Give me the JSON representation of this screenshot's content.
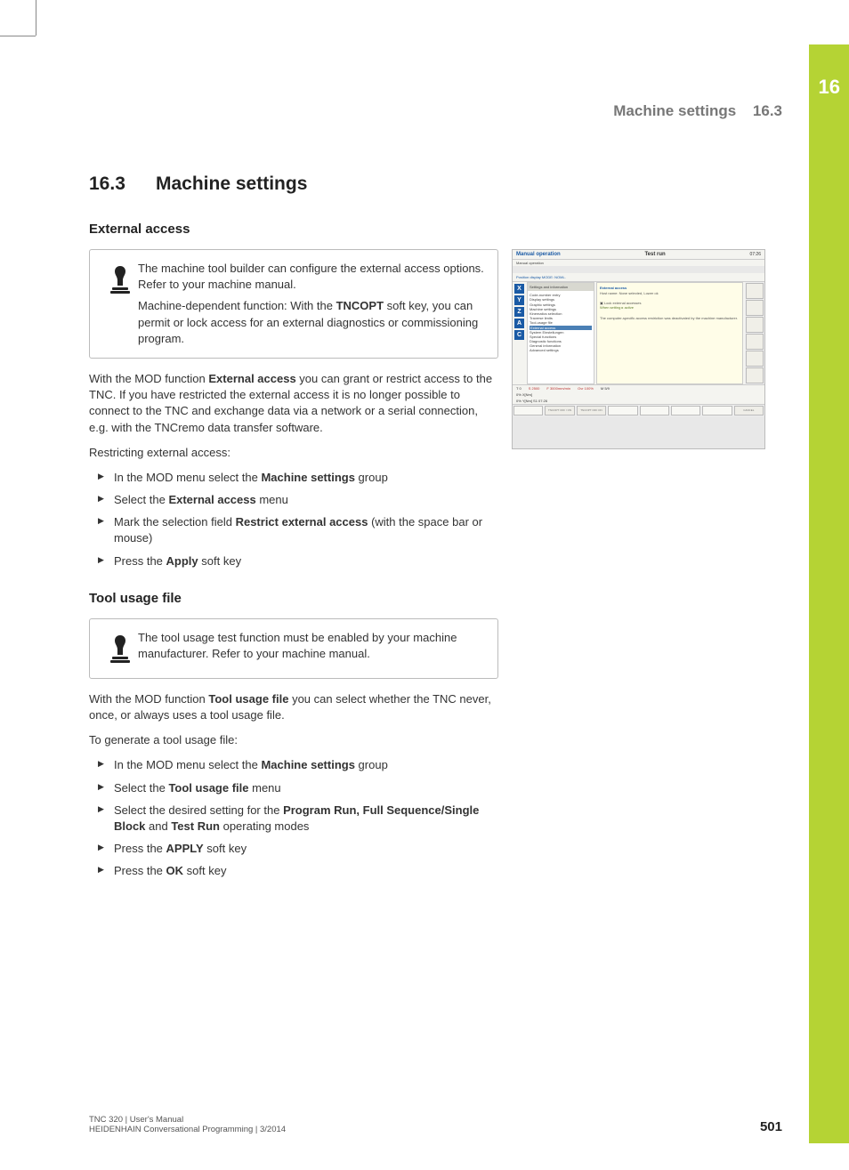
{
  "chapter_number": "16",
  "header": {
    "title": "Machine settings",
    "section": "16.3"
  },
  "section": {
    "number": "16.3",
    "title": "Machine settings"
  },
  "external_access": {
    "heading": "External access",
    "note_p1": "The machine tool builder can configure the external access options. Refer to your machine manual.",
    "note_p2a": "Machine-dependent function: With the ",
    "note_p2b": "TNCOPT",
    "note_p2c": " soft key, you can permit or lock access for an external diagnostics or commissioning program.",
    "body_a": "With the MOD function ",
    "body_b": "External access",
    "body_c": " you can grant or restrict access to the TNC. If you have restricted the external access it is no longer possible to connect to the TNC and exchange data via a network or a serial connection, e.g. with the TNCremo data transfer software.",
    "intro_steps": "Restricting external access:",
    "steps": {
      "s1a": "In the MOD menu select the ",
      "s1b": "Machine settings",
      "s1c": " group",
      "s2a": "Select the ",
      "s2b": "External access",
      "s2c": " menu",
      "s3a": "Mark the selection field ",
      "s3b": "Restrict external access",
      "s3c": " (with the space bar or mouse)",
      "s4a": "Press the ",
      "s4b": "Apply",
      "s4c": " soft key"
    }
  },
  "tool_usage": {
    "heading": "Tool usage file",
    "note": "The tool usage test function must be enabled by your machine manufacturer. Refer to your machine manual.",
    "body_a": "With the MOD function ",
    "body_b": "Tool usage file",
    "body_c": " you can select whether the TNC never, once, or always uses a tool usage file.",
    "intro_steps": "To generate a tool usage file:",
    "steps": {
      "s1a": "In the MOD menu select the ",
      "s1b": "Machine settings",
      "s1c": " group",
      "s2a": "Select the ",
      "s2b": "Tool usage file",
      "s2c": " menu",
      "s3a": "Select the desired setting for the ",
      "s3b": "Program Run, Full Sequence/Single Block",
      "s3c": " and ",
      "s3d": "Test Run",
      "s3e": " operating modes",
      "s4a": "Press the ",
      "s4b": "APPLY",
      "s4c": " soft key",
      "s5a": "Press the ",
      "s5b": "OK",
      "s5c": " soft key"
    }
  },
  "screenshot": {
    "title_left": "Manual operation",
    "title_right": "Test run",
    "time": "07:26",
    "subtitle": "Manual operation",
    "pos_line": "Position display MODE: NOML.",
    "axes": [
      "X",
      "Y",
      "Z",
      "A",
      "C"
    ],
    "tree_header": "Settings and information",
    "tree": [
      "Code-number entry",
      "Display settings",
      "Graphic settings",
      "Machine settings",
      "  Kinematics selection",
      "  Traverse limits",
      "  Tool-usage file"
    ],
    "tree_selected": "  External access",
    "tree_rest": [
      "System Einstellungen",
      "Special functions",
      "Diagnostic functions",
      "General information",
      "Advanced settings"
    ],
    "panel_title": "External access",
    "panel_line1": "Host name: None selected, Lower ok",
    "panel_lock_label": "Lock external accesses",
    "panel_lock_value": "When setting ▸ active",
    "panel_note": "The computer-specific access restriction was deactivated by the machine manufacturer.",
    "status_line": {
      "t": "T 0",
      "s": "S 2500",
      "f": "F 3000mm/min",
      "ovr": "Ovr 100%",
      "m": "M 5/9"
    },
    "feed1": "0% X[Nm]",
    "feed2": "0% Y[Nm] S1   07:26",
    "softkeys": [
      "",
      "TNCOPT OFF / ON",
      "TNCOPT OFF    ON",
      "",
      "",
      "",
      "",
      "CANCEL"
    ]
  },
  "footer": {
    "line1": "TNC 320 | User's Manual",
    "line2": "HEIDENHAIN Conversational Programming | 3/2014",
    "page": "501"
  }
}
